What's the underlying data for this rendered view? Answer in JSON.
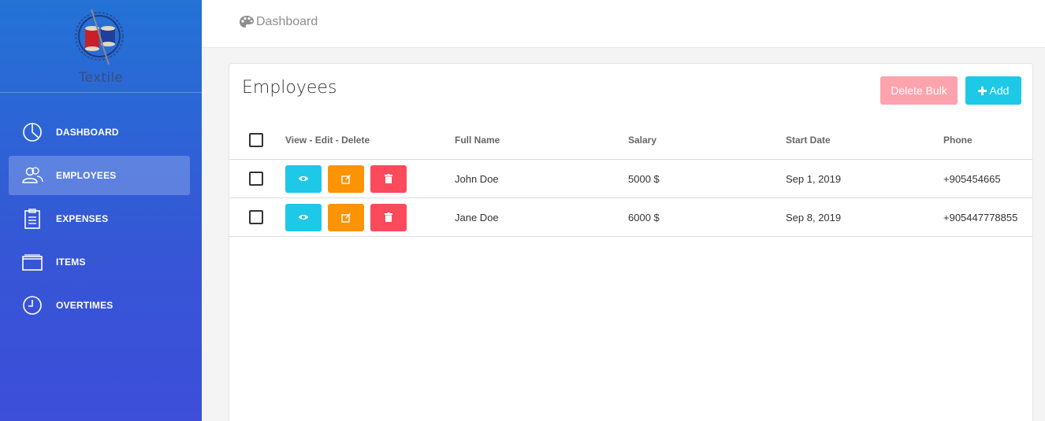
{
  "brand": {
    "name": "Textile",
    "logo_icon": "spool-logo-icon"
  },
  "sidebar": {
    "items": [
      {
        "label": "DASHBOARD",
        "icon": "pie-chart-icon",
        "active": false
      },
      {
        "label": "EMPLOYEES",
        "icon": "users-icon",
        "active": true
      },
      {
        "label": "EXPENSES",
        "icon": "clipboard-icon",
        "active": false
      },
      {
        "label": "ITEMS",
        "icon": "window-icon",
        "active": false
      },
      {
        "label": "OVERTIMES",
        "icon": "clock-icon",
        "active": false
      }
    ]
  },
  "topbar": {
    "breadcrumb": "Dashboard",
    "breadcrumb_icon": "palette-icon"
  },
  "card": {
    "title": "Employees",
    "delete_bulk_label": "Delete Bulk",
    "add_label": "Add",
    "add_icon": "plus-icon"
  },
  "table": {
    "headers": {
      "actions": "View - Edit - Delete",
      "full_name": "Full Name",
      "salary": "Salary",
      "start_date": "Start Date",
      "phone": "Phone"
    },
    "rows": [
      {
        "full_name": "John Doe",
        "salary": "5000 $",
        "start_date": "Sep 1, 2019",
        "phone": "+905454665"
      },
      {
        "full_name": "Jane Doe",
        "salary": "6000 $",
        "start_date": "Sep 8, 2019",
        "phone": "+905447778855"
      }
    ]
  },
  "colors": {
    "sidebar_top": "#2472d6",
    "sidebar_bottom": "#3d4ed8",
    "view": "#1ec8e7",
    "edit": "#fb9404",
    "delete": "#fa4a5b",
    "delete_bulk": "#fca3ad"
  }
}
